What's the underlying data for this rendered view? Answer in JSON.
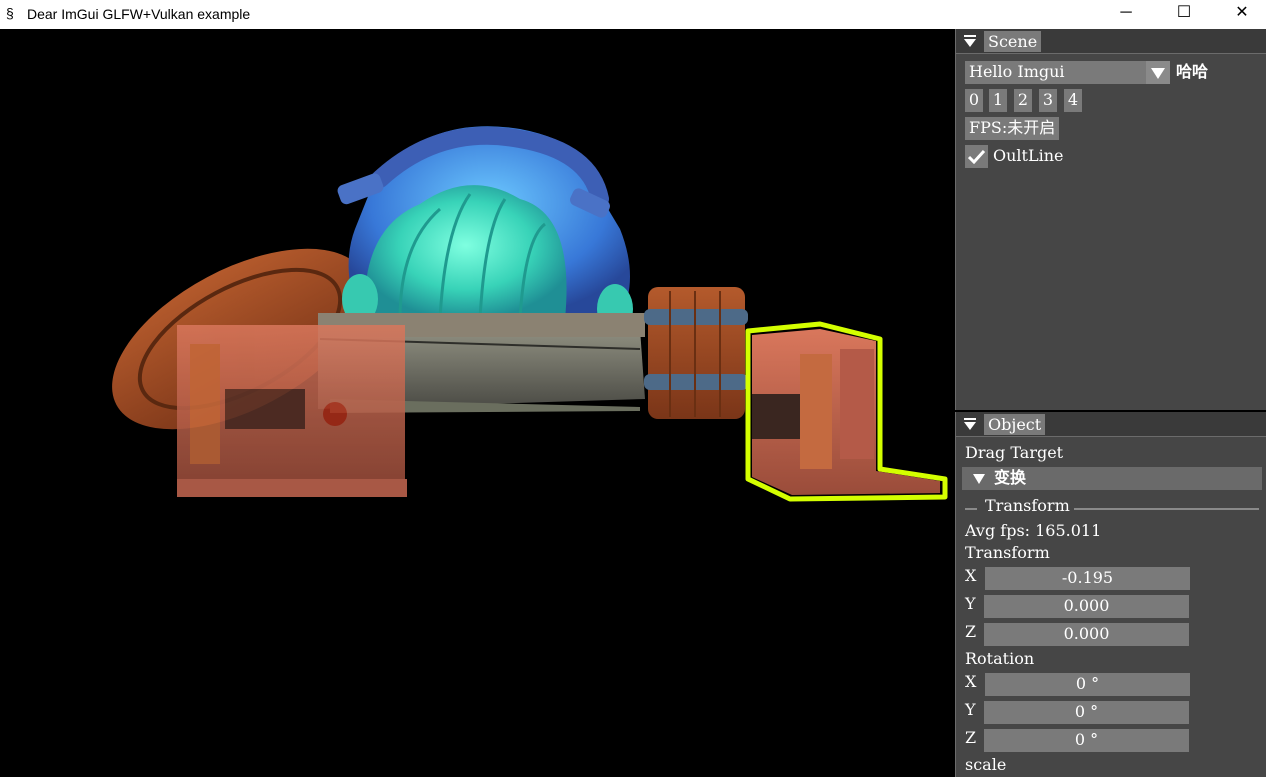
{
  "window": {
    "title": "Dear ImGui GLFW+Vulkan example",
    "icon": "app-icon",
    "minimize": "─",
    "maximize": "☐",
    "close": "✕"
  },
  "scene_panel": {
    "tab": "Scene",
    "combo_value": "Hello Imgui",
    "combo_side_label": "哈哈",
    "buttons": [
      "0",
      "1",
      "2",
      "3",
      "4"
    ],
    "fps_button": "FPS:未开启",
    "checkbox_label": "OultLine",
    "checkbox_checked": true
  },
  "object_panel": {
    "tab": "Object",
    "drag_target": "Drag Target",
    "header": "变换",
    "separator_text": "Transform",
    "avg_fps": "Avg fps: 165.011",
    "transform_label": "Transform",
    "transform": {
      "x_label": "X",
      "x": "-0.195",
      "y_label": "Y",
      "y": "0.000",
      "z_label": "Z",
      "z": "0.000"
    },
    "rotation_label": "Rotation",
    "rotation": {
      "x_label": "X",
      "x": "0 °",
      "y_label": "Y",
      "y": "0 °",
      "z_label": "Z",
      "z": "0 °"
    },
    "scale_label": "scale"
  },
  "colors": {
    "panel_bg": "#464646",
    "widget_bg": "#7a7a7a",
    "outline_highlight": "#d4ff00"
  }
}
